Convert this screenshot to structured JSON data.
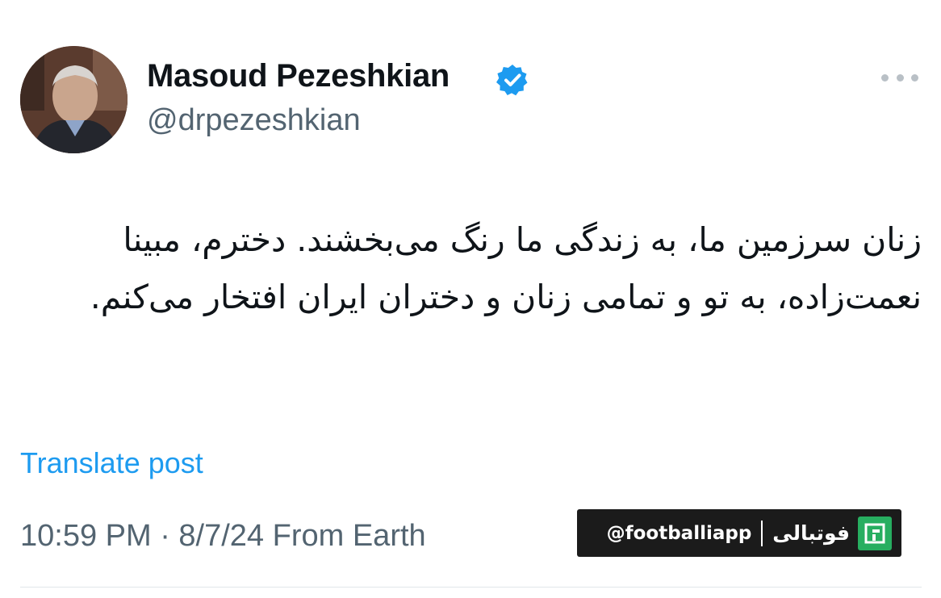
{
  "author": {
    "display_name": "Masoud Pezeshkian",
    "handle": "@drpezeshkian",
    "verified": true,
    "verified_badge_color": "#1d9bf0"
  },
  "tweet": {
    "text": "زنان سرزمین ما، به زندگی ما رنگ می‌بخشند. دخترم، مبینا نعمت‌زاده، به تو و تمامی زنان و دختران ایران افتخار می‌کنم.",
    "translate_label": "Translate post",
    "timestamp": "10:59 PM · 8/7/24 From Earth"
  },
  "watermark": {
    "handle": "@footballiapp",
    "name": "فوتبالی",
    "logo_color": "#27ae60"
  },
  "colors": {
    "text_primary": "#0f1419",
    "text_secondary": "#536471",
    "link": "#1d9bf0"
  },
  "icons": {
    "avatar": "profile-photo",
    "verified": "verified-badge-icon",
    "more": "more-options-icon"
  }
}
